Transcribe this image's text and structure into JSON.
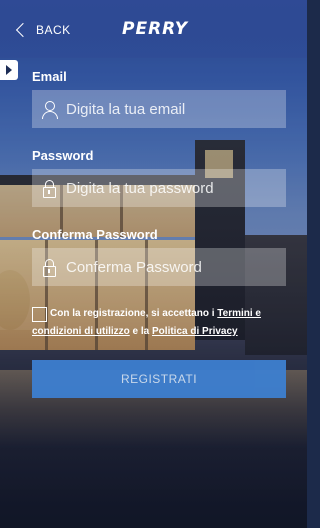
{
  "header": {
    "back_label": "BACK",
    "logo_text": "PERRY"
  },
  "form": {
    "email": {
      "label": "Email",
      "placeholder": "Digita la tua email",
      "icon": "user-icon"
    },
    "password": {
      "label": "Password",
      "placeholder": "Digita la tua password",
      "icon": "lock-icon"
    },
    "confirm": {
      "label": "Conferma Password",
      "placeholder": "Conferma Password",
      "icon": "lock-icon"
    },
    "terms": {
      "prefix": "Con la registrazione, si accettano i ",
      "terms_link": "Termini e condizioni di utilizzo",
      "middle": " e la ",
      "privacy_link": "Politica di Privacy",
      "checked": false
    },
    "submit_label": "REGISTRATI"
  },
  "colors": {
    "header": "#2f4a95",
    "button": "#3d7fd0"
  }
}
